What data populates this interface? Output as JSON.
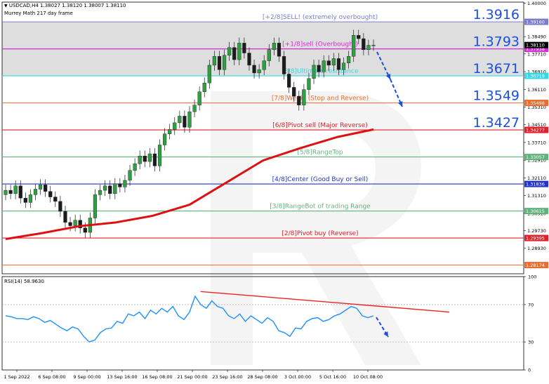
{
  "header": {
    "symbol_line": "USDCAD,H4  1.38027 1.38120 1.38007 1.38110",
    "indicator_name": "Murrey Math 217 day frame"
  },
  "rsi": {
    "label": "RSI(14) 58.9630",
    "ticks": [
      100,
      70,
      30,
      0
    ],
    "ylim": [
      0,
      100
    ]
  },
  "colors": {
    "ma": "#dd1111",
    "arrow": "#1a4fe0",
    "band": "#d6d6d6",
    "rsi_line": "#1e90ff",
    "trend": "#ee2222"
  },
  "chart_data": {
    "type": "line",
    "title": "USDCAD,H4",
    "ylim": [
      1.2778,
      1.4005
    ],
    "price_ticks": [
      "1.40000",
      "1.38490",
      "1.37710",
      "1.36910",
      "1.36110",
      "1.35310",
      "1.34510",
      "1.33710",
      "1.32910",
      "1.32110",
      "1.31310",
      "1.30510",
      "1.29730",
      "1.28930"
    ],
    "x_ticks": [
      "1 Sep 2022",
      "6 Sep 08:00",
      "9 Sep 00:00",
      "13 Sep 16:00",
      "16 Sep 08:00",
      "21 Sep 00:00",
      "23 Sep 16:00",
      "28 Sep 08:00",
      "3 Oct 00:00",
      "5 Oct 16:00",
      "10 Oct 08:00"
    ],
    "murrey_levels": [
      {
        "price": 1.3916,
        "tag": "1.39160",
        "text": "[+2/8]SELL! (extremely overbought)",
        "color": "#7c7ccc"
      },
      {
        "price": 1.37938,
        "tag": "1.37938",
        "text": "[+1/8]sell (Overbought)",
        "color": "#d62bd6"
      },
      {
        "price": 1.36719,
        "tag": "1.36719",
        "text": "[8/8]Ultimate resistance",
        "color": "#35d9e6"
      },
      {
        "price": 1.35498,
        "tag": "1.35498",
        "text": "[7/8]Weak, (Stop and Reverse)",
        "color": "#ee6a2a"
      },
      {
        "price": 1.34277,
        "tag": "1.34277",
        "text": "[6/8]Pivot sell (Major Reverse)",
        "color": "#e3202a"
      },
      {
        "price": 1.33057,
        "tag": "1.33057",
        "text": "[5/8]RangeTop",
        "color": "#5fb47a"
      },
      {
        "price": 1.31836,
        "tag": "1.31836",
        "text": "[4/8]Center (Good Buy or Sell)",
        "color": "#2233cc"
      },
      {
        "price": 1.30615,
        "tag": "1.30615",
        "text": "[3/8]RangeBot of trading Range",
        "color": "#5fb47a"
      },
      {
        "price": 1.29395,
        "tag": "1.29395",
        "text": "[2/8]Pivot buy (Reverse)",
        "color": "#e3202a"
      },
      {
        "price": 1.28174,
        "tag": "1.28174",
        "text": "",
        "color": "#ee6a2a"
      }
    ],
    "big_labels": [
      "1.3916",
      "1.3793",
      "1.3671",
      "1.3549",
      "1.3427"
    ],
    "price_tag": "1.38110",
    "price_close": [
      1.3155,
      1.314,
      1.3175,
      1.312,
      1.31,
      1.3135,
      1.316,
      1.318,
      1.315,
      1.3125,
      1.3105,
      1.306,
      1.301,
      1.2995,
      1.302,
      1.2985,
      1.2965,
      1.303,
      1.3135,
      1.3155,
      1.3175,
      1.314,
      1.3185,
      1.317,
      1.32,
      1.3245,
      1.3275,
      1.331,
      1.3285,
      1.332,
      1.3265,
      1.336,
      1.341,
      1.343,
      1.346,
      1.349,
      1.344,
      1.351,
      1.354,
      1.36,
      1.364,
      1.372,
      1.376,
      1.37,
      1.3765,
      1.38,
      1.3745,
      1.382,
      1.3775,
      1.372,
      1.3685,
      1.37,
      1.374,
      1.379,
      1.382,
      1.376,
      1.368,
      1.362,
      1.358,
      1.354,
      1.361,
      1.366,
      1.372,
      1.369,
      1.374,
      1.372,
      1.375,
      1.37,
      1.373,
      1.376,
      1.3855,
      1.384,
      1.379,
      1.381,
      1.3811
    ],
    "ma_path": [
      [
        0,
        1.2935
      ],
      [
        0.1,
        1.2962
      ],
      [
        0.2,
        1.2993
      ],
      [
        0.3,
        1.301
      ],
      [
        0.4,
        1.304
      ],
      [
        0.5,
        1.309
      ],
      [
        0.6,
        1.319
      ],
      [
        0.7,
        1.329
      ],
      [
        0.8,
        1.3345
      ],
      [
        0.9,
        1.3395
      ],
      [
        1.0,
        1.343
      ]
    ],
    "rsi_values": [
      58,
      57,
      55,
      55,
      54,
      57,
      55,
      51,
      53,
      49,
      45,
      42,
      46,
      44,
      36,
      30,
      32,
      40,
      44,
      45,
      52,
      50,
      60,
      58,
      62,
      55,
      64,
      60,
      66,
      62,
      68,
      58,
      54,
      62,
      79,
      70,
      66,
      74,
      68,
      66,
      58,
      55,
      60,
      52,
      58,
      54,
      50,
      56,
      52,
      42,
      40,
      36,
      45,
      44,
      52,
      55,
      56,
      52,
      54,
      58,
      60,
      64,
      68,
      66,
      58,
      56,
      58
    ],
    "rsi_trend": [
      [
        0.53,
        84
      ],
      [
        1.0,
        62
      ]
    ]
  }
}
